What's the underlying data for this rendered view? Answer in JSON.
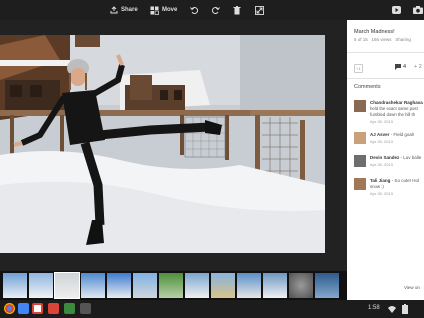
{
  "toolbar": {
    "share_label": "Share",
    "move_label": "Move"
  },
  "panel": {
    "title": "March Madness!",
    "count": "5 of 15",
    "views": "156 views",
    "sharing": "Sharing",
    "plus_one": "+1",
    "comment_count": "4",
    "plus_count": "+ 2",
    "comments_header": "Comments",
    "view_on": "View on"
  },
  "comments": [
    {
      "name": "Chandrashekar Raghava",
      "text1": "held the exact same post",
      "text2": "fumbled down the hill th",
      "date": "Apr 26, 2013"
    },
    {
      "name": "AJ Asver",
      "text1": "- Field goal!",
      "text2": "",
      "date": "Apr 26, 2013"
    },
    {
      "name": "Devin Sandez",
      "text1": "- Luv balle",
      "text2": "",
      "date": "Apr 26, 2013"
    },
    {
      "name": "Tali Jiang",
      "text1": "- So cute! Hol",
      "text2": "snow :)",
      "date": "Apr 26, 2013"
    }
  ],
  "taskbar": {
    "clock": "1:58"
  },
  "icons": [
    "share-icon",
    "move-icon",
    "rotate-left-icon",
    "rotate-right-icon",
    "trash-icon",
    "fullscreen-icon",
    "youtube-icon",
    "camera-icon",
    "comment-icon",
    "chevron-right-icon"
  ],
  "colors": {
    "accent_red": "#db4437",
    "toolbar_bg": "#1e1e1e",
    "panel_bg": "#ffffff"
  }
}
